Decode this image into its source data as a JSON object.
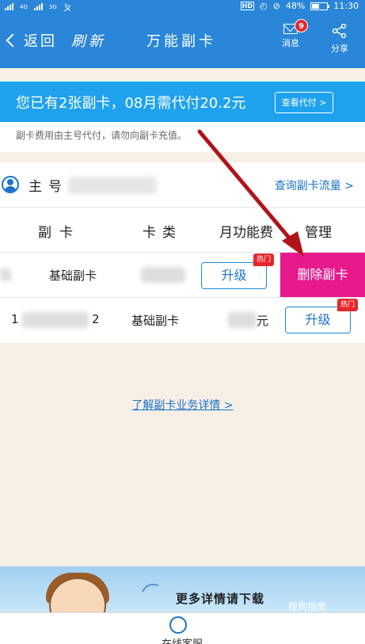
{
  "status_bar": {
    "net1": "4G",
    "net2": "3G",
    "hd": "HD",
    "battery": "48%",
    "time": "11:30"
  },
  "nav": {
    "back_label": "返回",
    "refresh_label": "刷新",
    "title": "万能副卡",
    "message_label": "消息",
    "message_badge": "9",
    "share_label": "分享"
  },
  "banner": {
    "text": "您已有2张副卡，08月需代付20.2元",
    "button_label": "查看代付 >"
  },
  "note": "副卡费用由主号代付，请勿向副卡充值。",
  "main_number": {
    "label": "主号",
    "flow_link": "查询副卡流量 >"
  },
  "table": {
    "headers": [
      "副卡",
      "卡类",
      "月功能费",
      "管理"
    ],
    "rows": [
      {
        "number_tail": "",
        "card_type": "基础副卡",
        "upgrade_label": "升级",
        "hot_label": "热门",
        "delete_label": "删除副卡"
      },
      {
        "number_head": "1",
        "number_tail": "2",
        "card_type": "基础副卡",
        "fee_unit": "元",
        "upgrade_label": "升级",
        "hot_label": "热门"
      }
    ]
  },
  "detail_link": "了解副卡业务详情 >",
  "ad": {
    "text": "更多详情请下载",
    "watermark": "搜狗指南"
  },
  "tabbar": {
    "service_label": "在线客服"
  },
  "colors": {
    "brand_blue": "#2a86d8",
    "banner_blue": "#1fa2ee",
    "delete_pink": "#e61a8d",
    "hot_red": "#e8262c",
    "arrow_red": "#b0141b"
  }
}
